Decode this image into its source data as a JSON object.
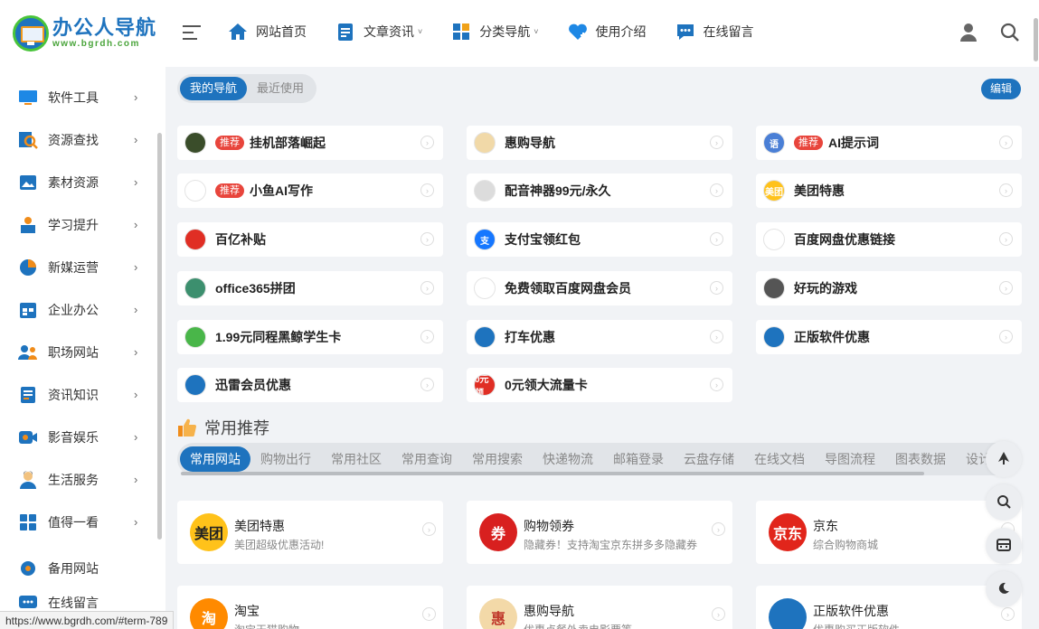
{
  "logo": {
    "title": "办公人导航",
    "url": "www.bgrdh.com"
  },
  "nav": {
    "items": [
      {
        "label": "网站首页",
        "icon": "home-icon",
        "has_caret": false
      },
      {
        "label": "文章资讯",
        "icon": "document-icon",
        "has_caret": true
      },
      {
        "label": "分类导航",
        "icon": "grid-icon",
        "has_caret": true
      },
      {
        "label": "使用介绍",
        "icon": "heart-icon",
        "has_caret": false
      },
      {
        "label": "在线留言",
        "icon": "chat-icon",
        "has_caret": false
      }
    ],
    "caret_glyph": "˅"
  },
  "sidebar": {
    "items": [
      {
        "label": "软件工具",
        "icon": "monitor-icon",
        "color": "#1e88e5"
      },
      {
        "label": "资源查找",
        "icon": "search-doc-icon",
        "color": "#f08c1a"
      },
      {
        "label": "素材资源",
        "icon": "image-icon",
        "color": "#1e73be"
      },
      {
        "label": "学习提升",
        "icon": "study-icon",
        "color": "#1e73be"
      },
      {
        "label": "新媒运营",
        "icon": "pie-icon",
        "color": "#f08c1a"
      },
      {
        "label": "企业办公",
        "icon": "calendar-icon",
        "color": "#1e73be"
      },
      {
        "label": "职场网站",
        "icon": "people-icon",
        "color": "#1e73be"
      },
      {
        "label": "资讯知识",
        "icon": "news-icon",
        "color": "#1e73be"
      },
      {
        "label": "影音娱乐",
        "icon": "video-icon",
        "color": "#1e73be"
      },
      {
        "label": "生活服务",
        "icon": "person-icon",
        "color": "#1e73be"
      },
      {
        "label": "值得一看",
        "icon": "apps-icon",
        "color": "#1e73be"
      }
    ],
    "extra": [
      {
        "label": "备用网站",
        "icon": "gear-icon"
      },
      {
        "label": "在线留言",
        "icon": "message-icon"
      }
    ],
    "chevron": "›"
  },
  "my_tabs": {
    "mine": "我的导航",
    "recent": "最近使用",
    "edit": "编辑"
  },
  "badge_text": "推荐",
  "arrow_glyph": "›",
  "quick_links": [
    {
      "label": "挂机部落崛起",
      "badge": true,
      "icon_color": "#3a4d2a",
      "icon_text": ""
    },
    {
      "label": "惠购导航",
      "badge": false,
      "icon_color": "#f1d9a8",
      "icon_text": ""
    },
    {
      "label": "AI提示词",
      "badge": true,
      "icon_color": "#4a7fd6",
      "icon_text": "语"
    },
    {
      "label": "小鱼AI写作",
      "badge": true,
      "icon_color": "#ffffff",
      "icon_text": ""
    },
    {
      "label": "配音神器99元/永久",
      "badge": false,
      "icon_color": "#dcdcdc",
      "icon_text": ""
    },
    {
      "label": "美团特惠",
      "badge": false,
      "icon_color": "#ffc21a",
      "icon_text": "美团"
    },
    {
      "label": "百亿补贴",
      "badge": false,
      "icon_color": "#e02e24",
      "icon_text": ""
    },
    {
      "label": "支付宝领红包",
      "badge": false,
      "icon_color": "#1677ff",
      "icon_text": "支"
    },
    {
      "label": "百度网盘优惠链接",
      "badge": false,
      "icon_color": "#ffffff",
      "icon_text": ""
    },
    {
      "label": "office365拼团",
      "badge": false,
      "icon_color": "#3c8f6e",
      "icon_text": ""
    },
    {
      "label": "免费领取百度网盘会员",
      "badge": false,
      "icon_color": "#ffffff",
      "icon_text": ""
    },
    {
      "label": "好玩的游戏",
      "badge": false,
      "icon_color": "#555555",
      "icon_text": ""
    },
    {
      "label": "1.99元同程黑鲸学生卡",
      "badge": false,
      "icon_color": "#49b649",
      "icon_text": ""
    },
    {
      "label": "打车优惠",
      "badge": false,
      "icon_color": "#1e73be",
      "icon_text": ""
    },
    {
      "label": "正版软件优惠",
      "badge": false,
      "icon_color": "#1e73be",
      "icon_text": ""
    },
    {
      "label": "迅雷会员优惠",
      "badge": false,
      "icon_color": "#1e73be",
      "icon_text": ""
    },
    {
      "label": "0元领大流量卡",
      "badge": false,
      "icon_color": "#e02e24",
      "icon_text": "0元领"
    }
  ],
  "section": {
    "title": "常用推荐"
  },
  "category_tabs": [
    "常用网站",
    "购物出行",
    "常用社区",
    "常用查询",
    "常用搜索",
    "快递物流",
    "邮箱登录",
    "云盘存储",
    "在线文档",
    "导图流程",
    "图表数据",
    "设计相"
  ],
  "recommendations": [
    {
      "title": "美团特惠",
      "desc": "美团超级优惠活动!",
      "icon_color": "#ffc21a",
      "icon_text": "美团",
      "icon_text_color": "#222"
    },
    {
      "title": "购物领券",
      "desc": "隐藏券！支持淘宝京东拼多多隐藏券",
      "icon_color": "#d8201f",
      "icon_text": "券",
      "icon_text_color": "#fff"
    },
    {
      "title": "京东",
      "desc": "综合购物商城",
      "icon_color": "#e1251b",
      "icon_text": "京东",
      "icon_text_color": "#fff"
    },
    {
      "title": "淘宝",
      "desc": "淘宝天猫购物",
      "icon_color": "#ff8a00",
      "icon_text": "淘",
      "icon_text_color": "#fff"
    },
    {
      "title": "惠购导航",
      "desc": "优惠点餐外卖电影票等",
      "icon_color": "#f3d9a8",
      "icon_text": "惠",
      "icon_text_color": "#c0392b"
    },
    {
      "title": "正版软件优惠",
      "desc": "优惠购买正版软件",
      "icon_color": "#1e73be",
      "icon_text": "",
      "icon_text_color": "#fff"
    }
  ],
  "float_buttons": [
    "up-arrow-icon",
    "search-icon",
    "calculator-icon",
    "moon-icon"
  ],
  "status_url": "https://www.bgrdh.com/#term-789",
  "colors": {
    "accent": "#1e73be",
    "badge": "#e8453c",
    "background": "#f1f3f6"
  }
}
